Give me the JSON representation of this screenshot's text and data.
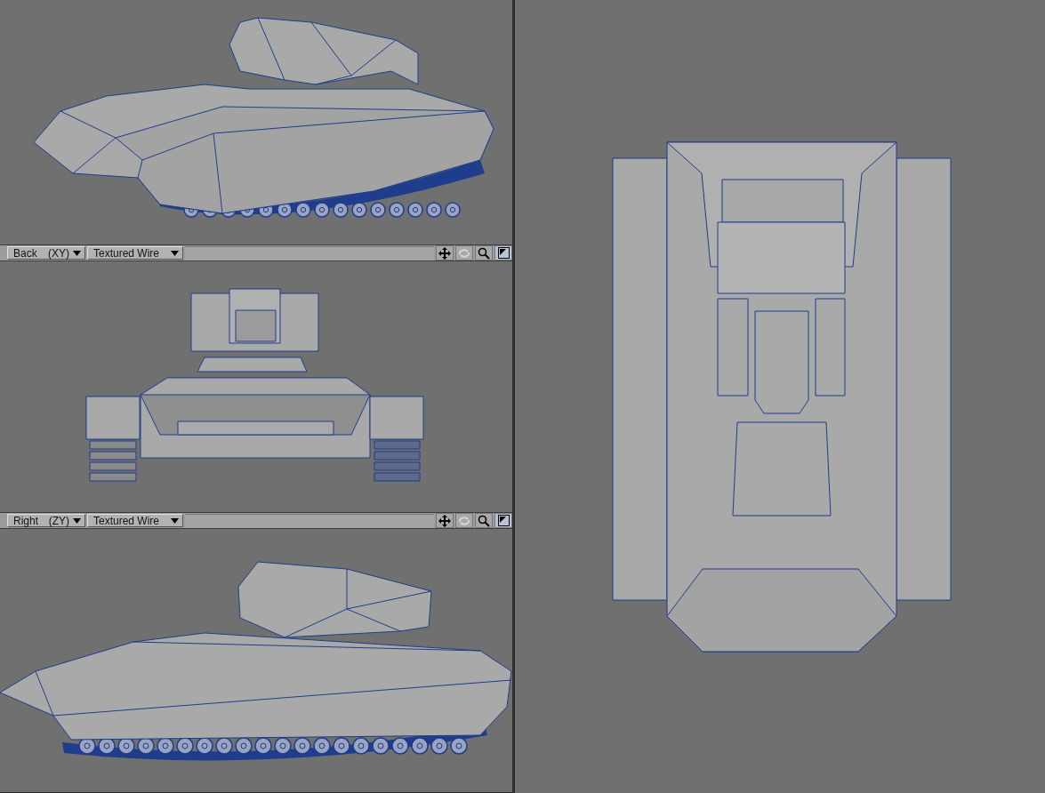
{
  "viewports": [
    {
      "kind": "perspective"
    },
    {
      "kind": "front",
      "header": {
        "view": "Back",
        "axes": "(XY)",
        "mode": "Textured Wire",
        "tools": [
          {
            "kind": "move",
            "disabled": false,
            "selected": false
          },
          {
            "kind": "rotate",
            "disabled": true,
            "selected": false
          },
          {
            "kind": "zoom",
            "disabled": false,
            "selected": false
          },
          {
            "kind": "maximize",
            "disabled": false,
            "selected": true
          }
        ]
      }
    },
    {
      "kind": "side",
      "header": {
        "view": "Right",
        "axes": "(ZY)",
        "mode": "Textured Wire",
        "tools": [
          {
            "kind": "move",
            "disabled": false,
            "selected": false
          },
          {
            "kind": "rotate",
            "disabled": true,
            "selected": false
          },
          {
            "kind": "zoom",
            "disabled": false,
            "selected": false
          },
          {
            "kind": "maximize",
            "disabled": false,
            "selected": true
          }
        ]
      }
    },
    {
      "kind": "top"
    }
  ]
}
